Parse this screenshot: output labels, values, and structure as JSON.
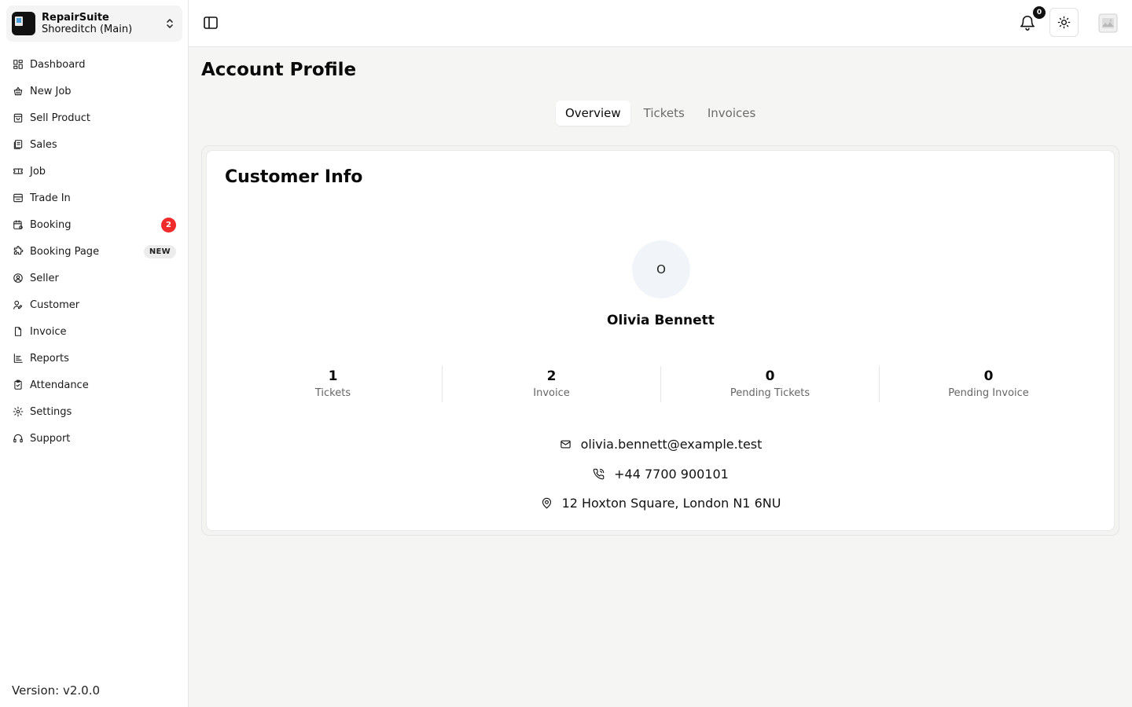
{
  "org": {
    "name": "RepairSuite",
    "branch": "Shoreditch (Main)"
  },
  "sidebar": {
    "items": [
      {
        "label": "Dashboard",
        "icon": "dashboard-icon"
      },
      {
        "label": "New Job",
        "icon": "new-job-icon"
      },
      {
        "label": "Sell Product",
        "icon": "shopping-bag-icon"
      },
      {
        "label": "Sales",
        "icon": "sales-icon"
      },
      {
        "label": "Job",
        "icon": "ticket-icon"
      },
      {
        "label": "Trade In",
        "icon": "trade-in-icon"
      },
      {
        "label": "Booking",
        "icon": "calendar-icon",
        "badge": "2"
      },
      {
        "label": "Booking Page",
        "icon": "puzzle-icon",
        "tag": "NEW"
      },
      {
        "label": "Seller",
        "icon": "user-circle-icon"
      },
      {
        "label": "Customer",
        "icon": "user-pen-icon"
      },
      {
        "label": "Invoice",
        "icon": "file-icon"
      },
      {
        "label": "Reports",
        "icon": "chart-icon"
      },
      {
        "label": "Attendance",
        "icon": "clipboard-icon"
      },
      {
        "label": "Settings",
        "icon": "gear-icon"
      },
      {
        "label": "Support",
        "icon": "headset-icon"
      }
    ],
    "version": "Version: v2.0.0"
  },
  "topbar": {
    "notification_count": "0"
  },
  "main": {
    "title": "Account Profile",
    "tabs": [
      "Overview",
      "Tickets",
      "Invoices"
    ],
    "active_tab": "Overview",
    "card": {
      "title": "Customer Info",
      "avatar_initial": "O",
      "name": "Olivia Bennett",
      "stats": [
        {
          "value": "1",
          "label": "Tickets"
        },
        {
          "value": "2",
          "label": "Invoice"
        },
        {
          "value": "0",
          "label": "Pending Tickets"
        },
        {
          "value": "0",
          "label": "Pending Invoice"
        }
      ],
      "email": "olivia.bennett@example.test",
      "phone": "+44 7700 900101",
      "address": "12 Hoxton Square, London N1 6NU"
    }
  },
  "colors": {
    "badge_red": "#ef2b2b",
    "main_bg": "#f5f5f4",
    "accent_dark": "#111111"
  }
}
